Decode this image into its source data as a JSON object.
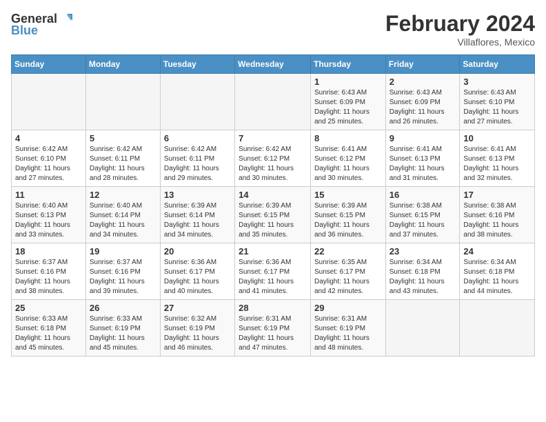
{
  "header": {
    "logo_line1": "General",
    "logo_line2": "Blue",
    "title": "February 2024",
    "subtitle": "Villaflores, Mexico"
  },
  "days_of_week": [
    "Sunday",
    "Monday",
    "Tuesday",
    "Wednesday",
    "Thursday",
    "Friday",
    "Saturday"
  ],
  "weeks": [
    [
      {
        "day": "",
        "info": ""
      },
      {
        "day": "",
        "info": ""
      },
      {
        "day": "",
        "info": ""
      },
      {
        "day": "",
        "info": ""
      },
      {
        "day": "1",
        "info": "Sunrise: 6:43 AM\nSunset: 6:09 PM\nDaylight: 11 hours and 25 minutes."
      },
      {
        "day": "2",
        "info": "Sunrise: 6:43 AM\nSunset: 6:09 PM\nDaylight: 11 hours and 26 minutes."
      },
      {
        "day": "3",
        "info": "Sunrise: 6:43 AM\nSunset: 6:10 PM\nDaylight: 11 hours and 27 minutes."
      }
    ],
    [
      {
        "day": "4",
        "info": "Sunrise: 6:42 AM\nSunset: 6:10 PM\nDaylight: 11 hours and 27 minutes."
      },
      {
        "day": "5",
        "info": "Sunrise: 6:42 AM\nSunset: 6:11 PM\nDaylight: 11 hours and 28 minutes."
      },
      {
        "day": "6",
        "info": "Sunrise: 6:42 AM\nSunset: 6:11 PM\nDaylight: 11 hours and 29 minutes."
      },
      {
        "day": "7",
        "info": "Sunrise: 6:42 AM\nSunset: 6:12 PM\nDaylight: 11 hours and 30 minutes."
      },
      {
        "day": "8",
        "info": "Sunrise: 6:41 AM\nSunset: 6:12 PM\nDaylight: 11 hours and 30 minutes."
      },
      {
        "day": "9",
        "info": "Sunrise: 6:41 AM\nSunset: 6:13 PM\nDaylight: 11 hours and 31 minutes."
      },
      {
        "day": "10",
        "info": "Sunrise: 6:41 AM\nSunset: 6:13 PM\nDaylight: 11 hours and 32 minutes."
      }
    ],
    [
      {
        "day": "11",
        "info": "Sunrise: 6:40 AM\nSunset: 6:13 PM\nDaylight: 11 hours and 33 minutes."
      },
      {
        "day": "12",
        "info": "Sunrise: 6:40 AM\nSunset: 6:14 PM\nDaylight: 11 hours and 34 minutes."
      },
      {
        "day": "13",
        "info": "Sunrise: 6:39 AM\nSunset: 6:14 PM\nDaylight: 11 hours and 34 minutes."
      },
      {
        "day": "14",
        "info": "Sunrise: 6:39 AM\nSunset: 6:15 PM\nDaylight: 11 hours and 35 minutes."
      },
      {
        "day": "15",
        "info": "Sunrise: 6:39 AM\nSunset: 6:15 PM\nDaylight: 11 hours and 36 minutes."
      },
      {
        "day": "16",
        "info": "Sunrise: 6:38 AM\nSunset: 6:15 PM\nDaylight: 11 hours and 37 minutes."
      },
      {
        "day": "17",
        "info": "Sunrise: 6:38 AM\nSunset: 6:16 PM\nDaylight: 11 hours and 38 minutes."
      }
    ],
    [
      {
        "day": "18",
        "info": "Sunrise: 6:37 AM\nSunset: 6:16 PM\nDaylight: 11 hours and 38 minutes."
      },
      {
        "day": "19",
        "info": "Sunrise: 6:37 AM\nSunset: 6:16 PM\nDaylight: 11 hours and 39 minutes."
      },
      {
        "day": "20",
        "info": "Sunrise: 6:36 AM\nSunset: 6:17 PM\nDaylight: 11 hours and 40 minutes."
      },
      {
        "day": "21",
        "info": "Sunrise: 6:36 AM\nSunset: 6:17 PM\nDaylight: 11 hours and 41 minutes."
      },
      {
        "day": "22",
        "info": "Sunrise: 6:35 AM\nSunset: 6:17 PM\nDaylight: 11 hours and 42 minutes."
      },
      {
        "day": "23",
        "info": "Sunrise: 6:34 AM\nSunset: 6:18 PM\nDaylight: 11 hours and 43 minutes."
      },
      {
        "day": "24",
        "info": "Sunrise: 6:34 AM\nSunset: 6:18 PM\nDaylight: 11 hours and 44 minutes."
      }
    ],
    [
      {
        "day": "25",
        "info": "Sunrise: 6:33 AM\nSunset: 6:18 PM\nDaylight: 11 hours and 45 minutes."
      },
      {
        "day": "26",
        "info": "Sunrise: 6:33 AM\nSunset: 6:19 PM\nDaylight: 11 hours and 45 minutes."
      },
      {
        "day": "27",
        "info": "Sunrise: 6:32 AM\nSunset: 6:19 PM\nDaylight: 11 hours and 46 minutes."
      },
      {
        "day": "28",
        "info": "Sunrise: 6:31 AM\nSunset: 6:19 PM\nDaylight: 11 hours and 47 minutes."
      },
      {
        "day": "29",
        "info": "Sunrise: 6:31 AM\nSunset: 6:19 PM\nDaylight: 11 hours and 48 minutes."
      },
      {
        "day": "",
        "info": ""
      },
      {
        "day": "",
        "info": ""
      }
    ]
  ]
}
